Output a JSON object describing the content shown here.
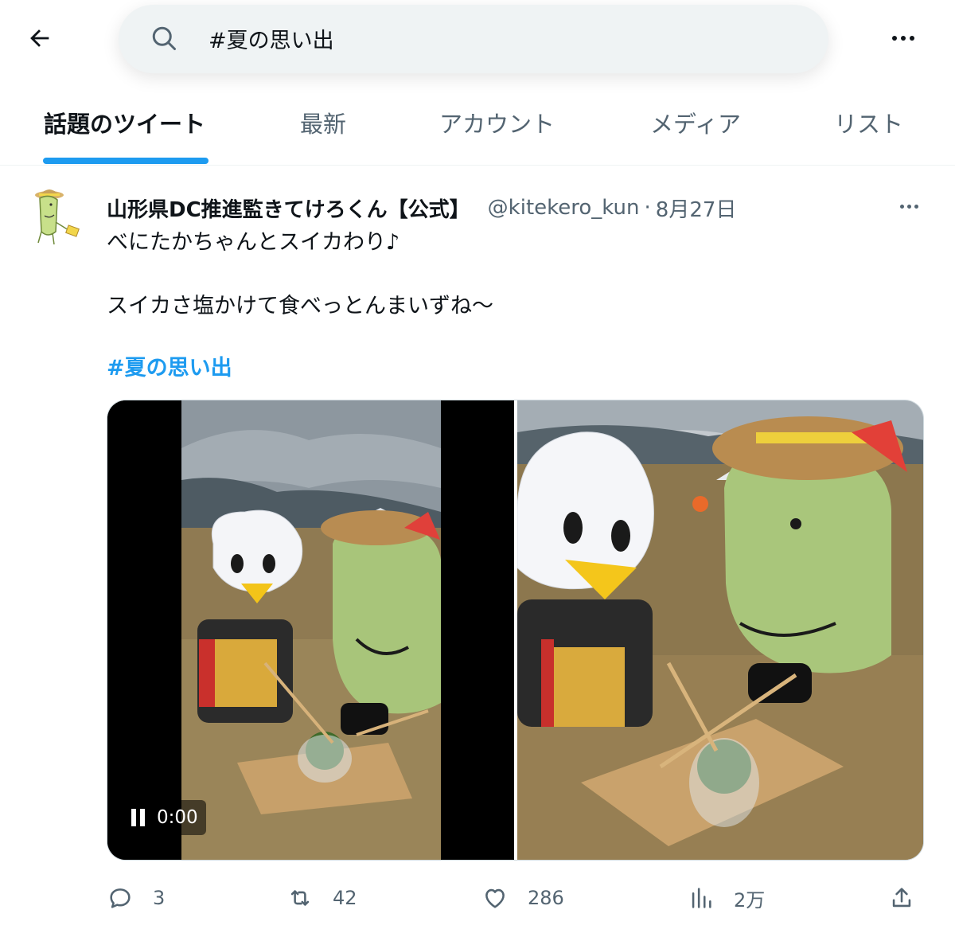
{
  "header": {
    "search_query": "#夏の思い出"
  },
  "tabs": [
    {
      "label": "話題のツイート",
      "active": true
    },
    {
      "label": "最新",
      "active": false
    },
    {
      "label": "アカウント",
      "active": false
    },
    {
      "label": "メディア",
      "active": false
    },
    {
      "label": "リスト",
      "active": false
    }
  ],
  "tweet": {
    "display_name": "山形県DC推進監きてけろくん【公式】",
    "handle": "@kitekero_kun",
    "separator": "·",
    "date": "8月27日",
    "text_lines": [
      "べにたかちゃんとスイカわり♪",
      "スイカさ塩かけて食べっとんまいずね〜"
    ],
    "hashtag": "#夏の思い出",
    "video": {
      "time": "0:00",
      "state": "playing"
    },
    "actions": {
      "replies": "3",
      "retweets": "42",
      "likes": "286",
      "views": "2万"
    }
  },
  "colors": {
    "accent": "#1d9bf0",
    "text_primary": "#0f1419",
    "text_secondary": "#536471",
    "search_bg": "#eff3f4"
  }
}
